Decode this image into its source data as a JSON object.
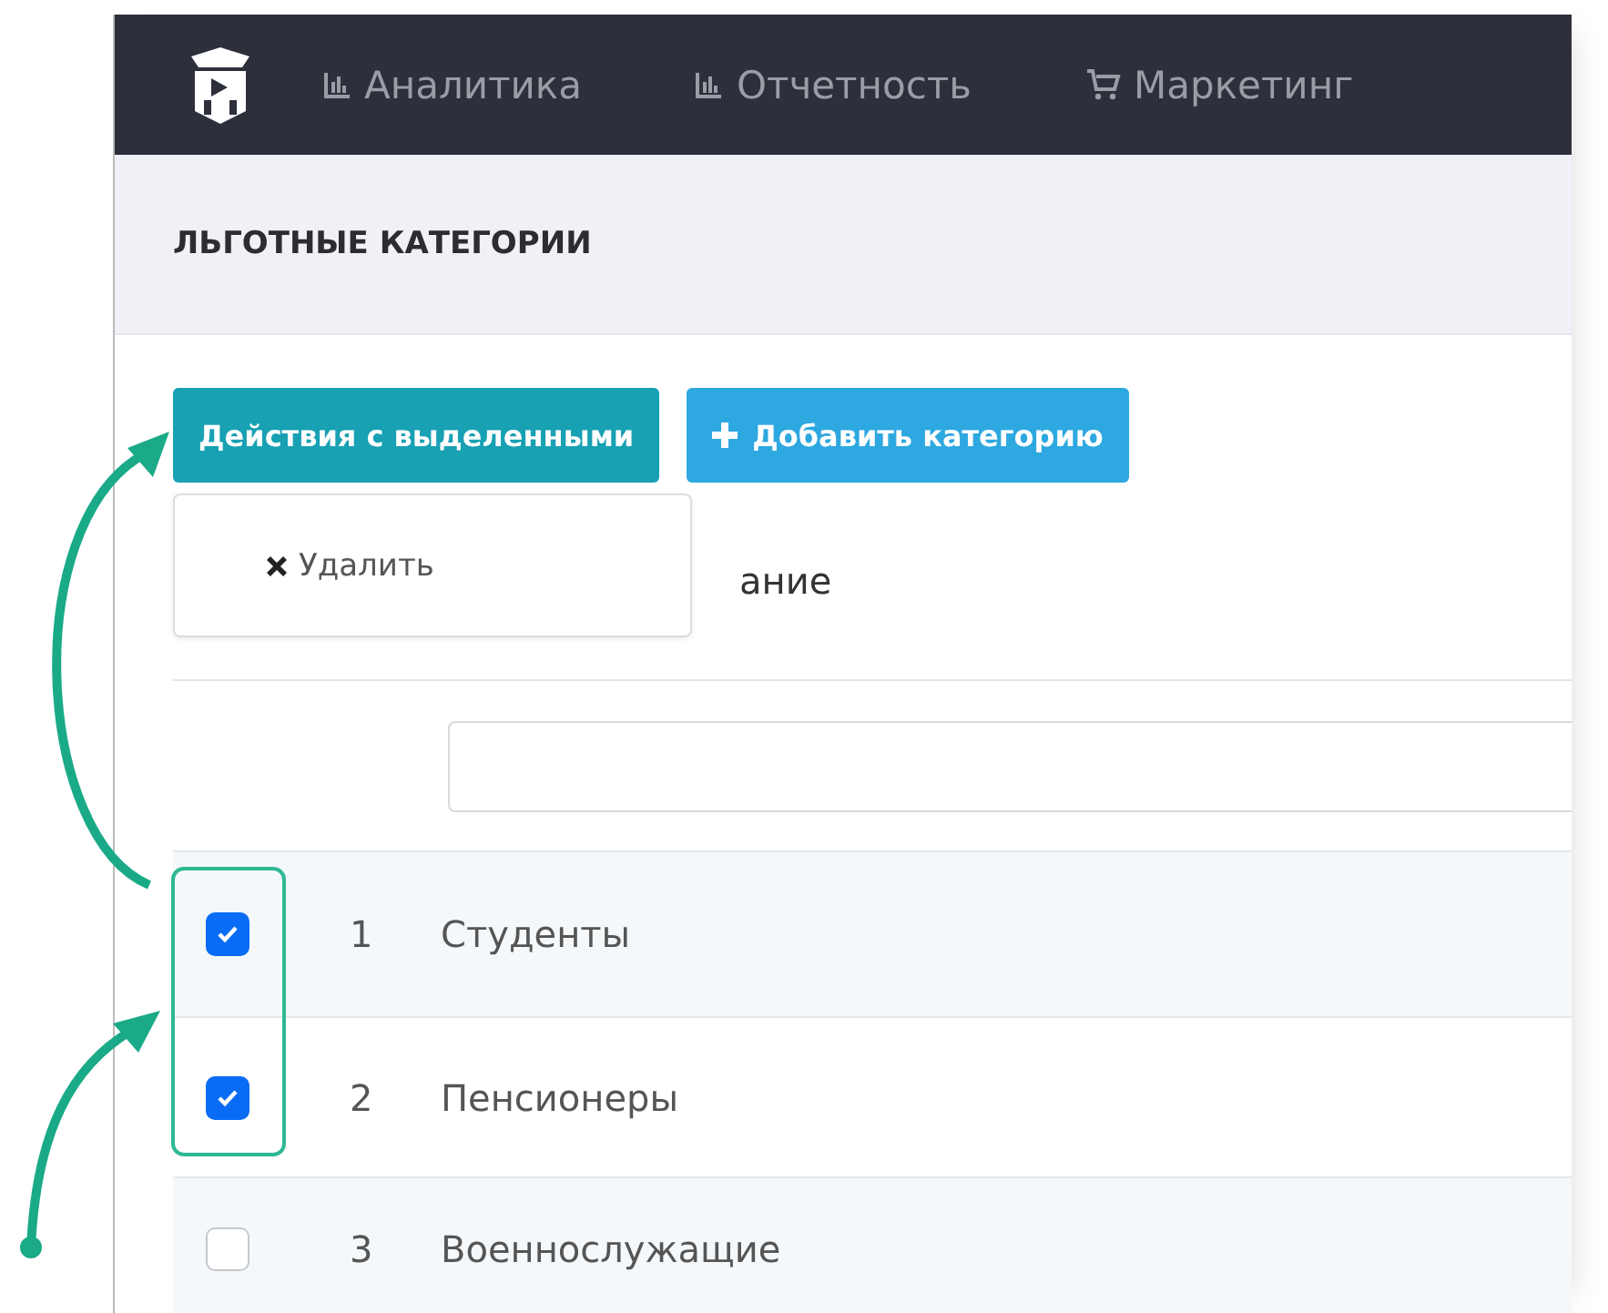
{
  "navbar": {
    "items": [
      {
        "label": "Аналитика",
        "kind": "chart"
      },
      {
        "label": "Отчетность",
        "kind": "chart"
      },
      {
        "label": "Маркетинг",
        "kind": "cart"
      }
    ]
  },
  "page_title": "ЛЬГОТНЫЕ КАТЕГОРИИ",
  "toolbar": {
    "buttons": [
      {
        "label": "Действия с выделенными",
        "kind": "actions"
      },
      {
        "label": "Добавить категорию",
        "kind": "add"
      }
    ]
  },
  "dropdown": {
    "items": [
      {
        "label": "Удалить"
      }
    ]
  },
  "table": {
    "columns": [
      "ание"
    ],
    "rows": [
      {
        "checked": true,
        "number": "1",
        "name": "Студенты"
      },
      {
        "checked": true,
        "number": "2",
        "name": "Пенсионеры"
      },
      {
        "checked": false,
        "number": "3",
        "name": "Военнослужащие"
      }
    ]
  }
}
